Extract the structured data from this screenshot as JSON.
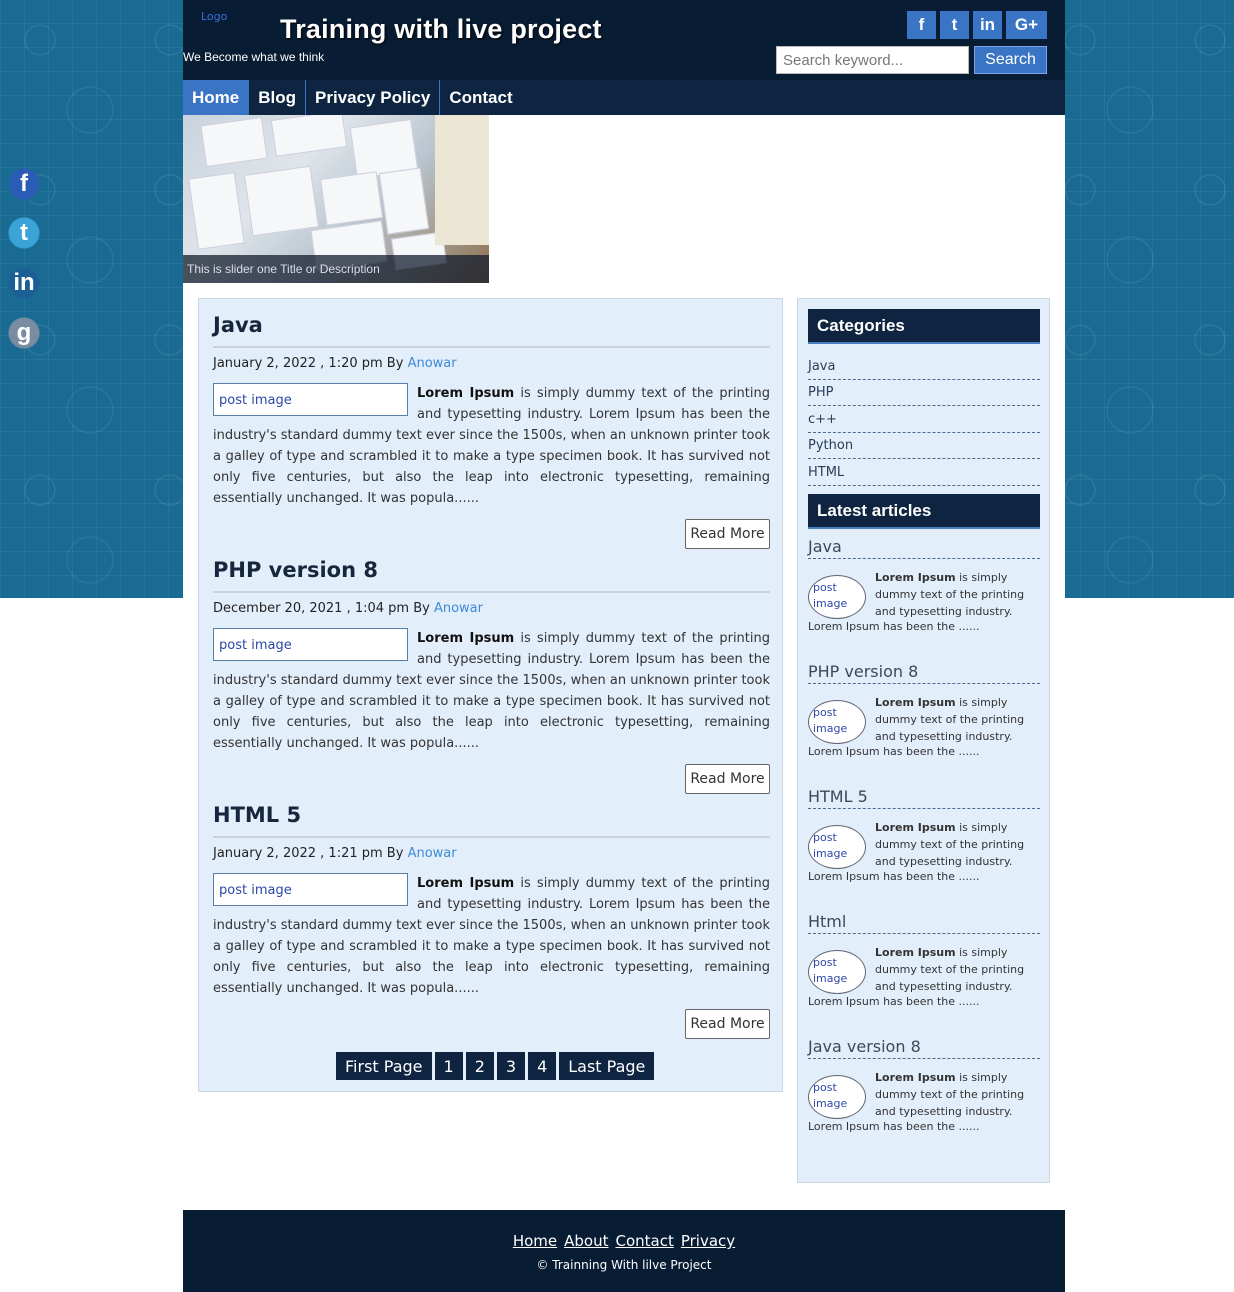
{
  "header": {
    "logo_alt": "Logo",
    "title": "Training with live project",
    "tagline": "We Become what we think",
    "social": [
      "f",
      "t",
      "in",
      "G+"
    ],
    "search_placeholder": "Search keyword...",
    "search_button": "Search"
  },
  "nav": {
    "items": [
      {
        "label": "Home"
      },
      {
        "label": "Blog"
      },
      {
        "label": "Privacy Policy"
      },
      {
        "label": "Contact"
      }
    ]
  },
  "slider": {
    "caption": "This is slider one Title or Description"
  },
  "posts": [
    {
      "title": "Java",
      "date": "January 2, 2022 , 1:20 pm By",
      "author": "Anowar",
      "image_alt": "post image",
      "lead": "Lorem Ipsum",
      "body": "is simply dummy text of the printing and typesetting industry. Lorem Ipsum has been the industry's standard dummy text ever since the 1500s, when an unknown printer took a galley of type and scrambled it to make a type specimen book. It has survived not only five centuries, but also the leap into electronic typesetting, remaining essentially unchanged. It was popula......",
      "read_more": "Read More"
    },
    {
      "title": "PHP version 8",
      "date": "December 20, 2021 , 1:04 pm By",
      "author": "Anowar",
      "image_alt": "post image",
      "lead": "Lorem Ipsum",
      "body": "is simply dummy text of the printing and typesetting industry. Lorem Ipsum has been the industry's standard dummy text ever since the 1500s, when an unknown printer took a galley of type and scrambled it to make a type specimen book. It has survived not only five centuries, but also the leap into electronic typesetting, remaining essentially unchanged. It was popula......",
      "read_more": "Read More"
    },
    {
      "title": "HTML 5",
      "date": "January 2, 2022 , 1:21 pm By",
      "author": "Anowar",
      "image_alt": "post image",
      "lead": "Lorem Ipsum",
      "body": "is simply dummy text of the printing and typesetting industry. Lorem Ipsum has been the industry's standard dummy text ever since the 1500s, when an unknown printer took a galley of type and scrambled it to make a type specimen book. It has survived not only five centuries, but also the leap into electronic typesetting, remaining essentially unchanged. It was popula......",
      "read_more": "Read More"
    }
  ],
  "pagination": {
    "first": "First Page",
    "pages": [
      "1",
      "2",
      "3",
      "4"
    ],
    "last": "Last Page"
  },
  "sidebar": {
    "categories_title": "Categories",
    "categories": [
      "Java",
      "PHP",
      "c++",
      "Python",
      "HTML"
    ],
    "latest_title": "Latest articles",
    "articles": [
      {
        "title": "Java",
        "thumb_alt": "post image",
        "lead": "Lorem Ipsum",
        "text": "is simply dummy text of the printing and typesetting industry.",
        "tail": "Lorem Ipsum has been the ......"
      },
      {
        "title": "PHP version 8",
        "thumb_alt": "post image",
        "lead": "Lorem Ipsum",
        "text": "is simply dummy text of the printing and typesetting industry.",
        "tail": "Lorem Ipsum has been the ......"
      },
      {
        "title": "HTML 5",
        "thumb_alt": "post image",
        "lead": "Lorem Ipsum",
        "text": "is simply dummy text of the printing and typesetting industry.",
        "tail": "Lorem Ipsum has been the ......"
      },
      {
        "title": "Html",
        "thumb_alt": "post image",
        "lead": "Lorem Ipsum",
        "text": "is simply dummy text of the printing and typesetting industry.",
        "tail": "Lorem Ipsum has been the ......"
      },
      {
        "title": "Java version 8",
        "thumb_alt": "post image",
        "lead": "Lorem Ipsum",
        "text": "is simply dummy text of the printing and typesetting industry.",
        "tail": "Lorem Ipsum has been the ......"
      }
    ]
  },
  "footer": {
    "links": [
      "Home",
      "About",
      "Contact",
      "Privacy"
    ],
    "copyright": "© Trainning With lilve Project"
  },
  "float_social": [
    "f",
    "t",
    "in",
    "g"
  ],
  "colors": {
    "header_bg": "#081c33",
    "accent": "#3a74c4",
    "content_bg": "#e3eefb",
    "author_link": "#3d8ad8"
  }
}
